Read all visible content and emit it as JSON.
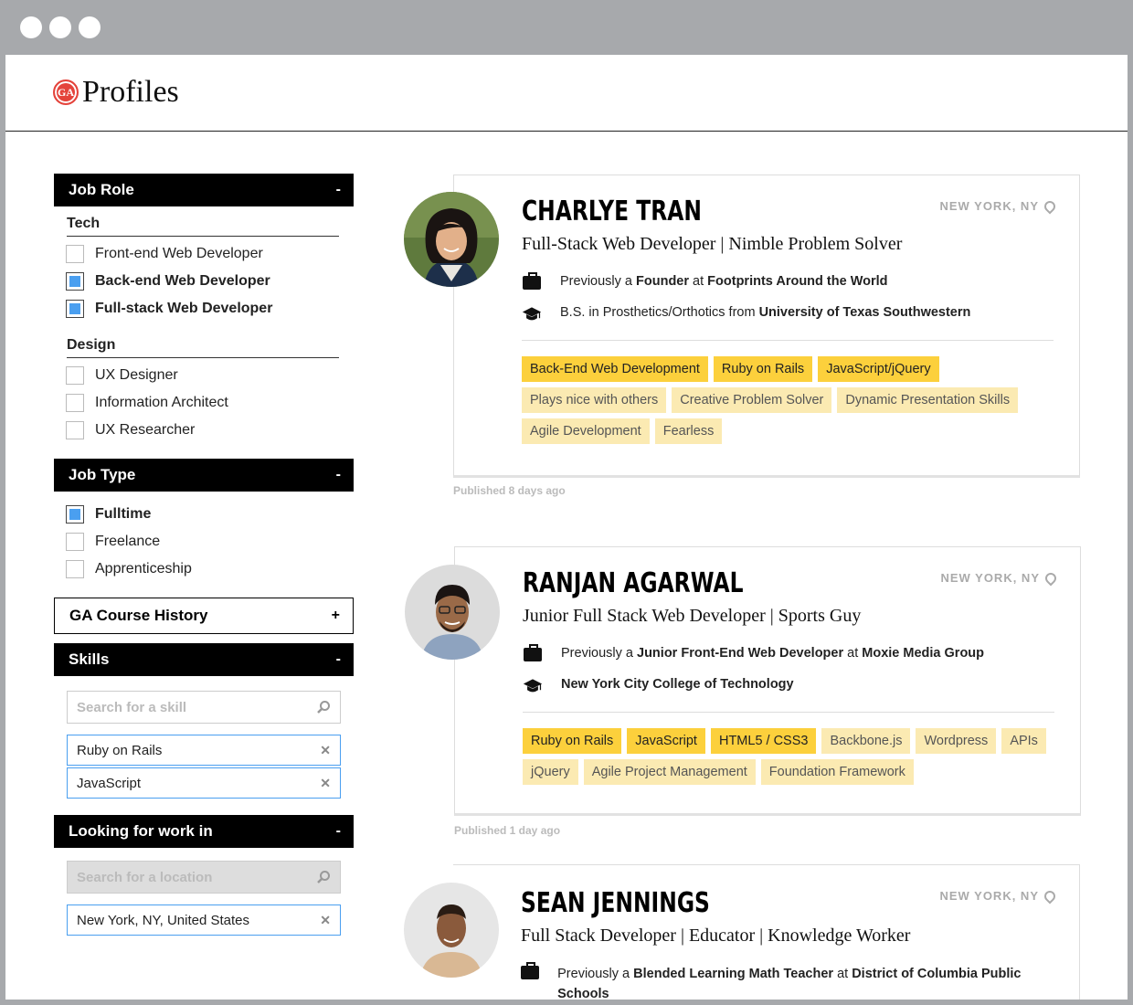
{
  "app": {
    "logo_badge": "GA",
    "title": "Profiles"
  },
  "filters": {
    "job_role": {
      "label": "Job Role",
      "toggle": "-",
      "groups": [
        {
          "label": "Tech",
          "items": [
            {
              "label": "Front-end Web Developer",
              "checked": false
            },
            {
              "label": "Back-end Web Developer",
              "checked": true
            },
            {
              "label": "Full-stack Web Developer",
              "checked": true
            }
          ]
        },
        {
          "label": "Design",
          "items": [
            {
              "label": "UX Designer",
              "checked": false
            },
            {
              "label": "Information Architect",
              "checked": false
            },
            {
              "label": "UX Researcher",
              "checked": false
            }
          ]
        }
      ]
    },
    "job_type": {
      "label": "Job Type",
      "toggle": "-",
      "items": [
        {
          "label": "Fulltime",
          "checked": true
        },
        {
          "label": "Freelance",
          "checked": false
        },
        {
          "label": "Apprenticeship",
          "checked": false
        }
      ]
    },
    "course_history": {
      "label": "GA Course History",
      "toggle": "+"
    },
    "skills": {
      "label": "Skills",
      "toggle": "-",
      "search_placeholder": "Search for a skill",
      "selected": [
        "Ruby on Rails",
        "JavaScript"
      ]
    },
    "location": {
      "label": "Looking for work in",
      "toggle": "-",
      "search_placeholder": "Search for a location",
      "selected": [
        "New York, NY, United States"
      ]
    }
  },
  "profiles": [
    {
      "name": "CHARLYE TRAN",
      "location": "NEW YORK, NY",
      "tagline": "Full-Stack Web Developer | Nimble Problem Solver",
      "work": {
        "prefix": "Previously a ",
        "role": "Founder",
        "mid": " at ",
        "org": "Footprints Around the World"
      },
      "edu": {
        "prefix": "B.S. in Prosthetics/Orthotics from ",
        "school": "University of Texas Southwestern"
      },
      "tags_hi": [
        "Back-End Web Development",
        "Ruby on Rails",
        "JavaScript/jQuery"
      ],
      "tags": [
        "Plays nice with others",
        "Creative Problem Solver",
        "Dynamic Presentation Skills",
        "Agile Development",
        "Fearless"
      ],
      "published": "Published 8 days ago"
    },
    {
      "name": "RANJAN AGARWAL",
      "location": "NEW YORK, NY",
      "tagline": "Junior Full Stack Web Developer | Sports Guy",
      "work": {
        "prefix": "Previously a ",
        "role": "Junior Front-End Web Developer",
        "mid": " at ",
        "org": "Moxie Media Group"
      },
      "edu": {
        "prefix": "",
        "school": "New York City College of Technology"
      },
      "tags_hi": [
        "Ruby on Rails",
        "JavaScript",
        "HTML5 / CSS3"
      ],
      "tags": [
        "Backbone.js",
        "Wordpress",
        "APIs",
        "jQuery",
        "Agile Project Management",
        "Foundation Framework"
      ],
      "published": "Published 1 day ago"
    },
    {
      "name": "SEAN JENNINGS",
      "location": "NEW YORK, NY",
      "tagline": "Full Stack Developer | Educator | Knowledge Worker",
      "work": {
        "prefix": "Previously a ",
        "role": "Blended Learning Math Teacher",
        "mid": " at ",
        "org": "District of Columbia Public Schools"
      }
    }
  ],
  "colors": {
    "accent_checkbox": "#4a9ff0",
    "tag_highlight": "#fcd03c",
    "tag_soft": "#fbeab2",
    "logo_red": "#e4433b"
  }
}
